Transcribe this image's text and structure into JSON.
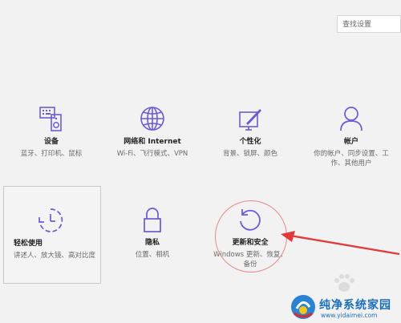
{
  "search": {
    "placeholder": "查找设置"
  },
  "tiles": [
    {
      "title": "设备",
      "desc": "蓝牙、打印机、鼠标",
      "icon": "devices-icon"
    },
    {
      "title": "网络和 Internet",
      "desc": "Wi-Fi、飞行模式、VPN",
      "icon": "globe-icon"
    },
    {
      "title": "个性化",
      "desc": "背景、锁屏、颜色",
      "icon": "personalization-icon"
    },
    {
      "title": "帐户",
      "desc": "你的帐户、同步设置、工作、其他用户",
      "icon": "person-icon"
    },
    {
      "title": "轻松使用",
      "desc": "讲述人、放大镜、高对比度",
      "icon": "ease-of-access-icon"
    },
    {
      "title": "隐私",
      "desc": "位置、相机",
      "icon": "lock-icon"
    },
    {
      "title": "更新和安全",
      "desc": "Windows 更新、恢复、备份",
      "icon": "refresh-icon"
    }
  ],
  "watermark": {
    "title": "纯净系统家园",
    "url": "www.yidaimei.com"
  },
  "accent_color": "#6b5bd6",
  "annotation_color": "#e23a3a"
}
